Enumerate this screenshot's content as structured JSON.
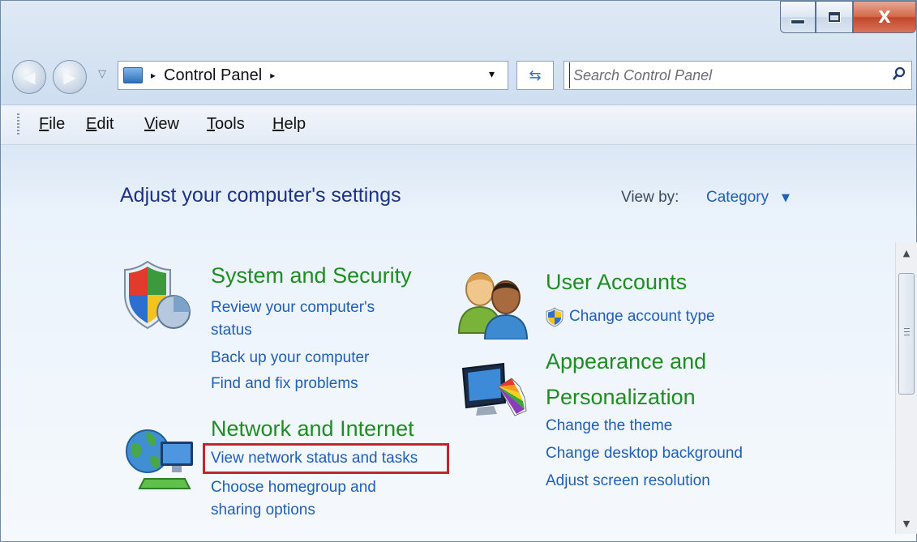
{
  "window": {
    "caption_buttons": {
      "close_label": "X"
    }
  },
  "nav": {
    "back_icon": "back-arrow-icon",
    "forward_icon": "forward-arrow-icon",
    "address": {
      "arrow": "▸",
      "location": "Control Panel",
      "trail_arrow": "▸",
      "dropdown": "▾"
    },
    "refresh_glyph": "⇆",
    "search": {
      "placeholder": "Search Control Panel",
      "value": ""
    }
  },
  "menu": [
    "File",
    "Edit",
    "View",
    "Tools",
    "Help"
  ],
  "main": {
    "title": "Adjust your computer's settings",
    "view_by_label": "View by:",
    "view_by_value": "Category",
    "categories": [
      {
        "title": "System and Security",
        "icon": "shield-chart-icon",
        "links": [
          "Review your computer's",
          "status",
          "Back up your computer",
          "Find and fix problems"
        ]
      },
      {
        "title": "Network and Internet",
        "icon": "network-globe-icon",
        "links": [
          "View network status and tasks",
          "Choose homegroup and",
          "sharing options"
        ]
      },
      {
        "title": "User Accounts",
        "icon": "users-icon",
        "links": [
          "Change account type"
        ]
      },
      {
        "title_line1": "Appearance and",
        "title_line2": "Personalization",
        "icon": "monitor-palette-icon",
        "links": [
          "Change the theme",
          "Change desktop background",
          "Adjust screen resolution"
        ]
      }
    ],
    "highlighted_link": "View network status and tasks"
  },
  "colors": {
    "category_title": "#1e8d22",
    "link": "#1f5fb5",
    "highlight_border": "#c0272d"
  }
}
